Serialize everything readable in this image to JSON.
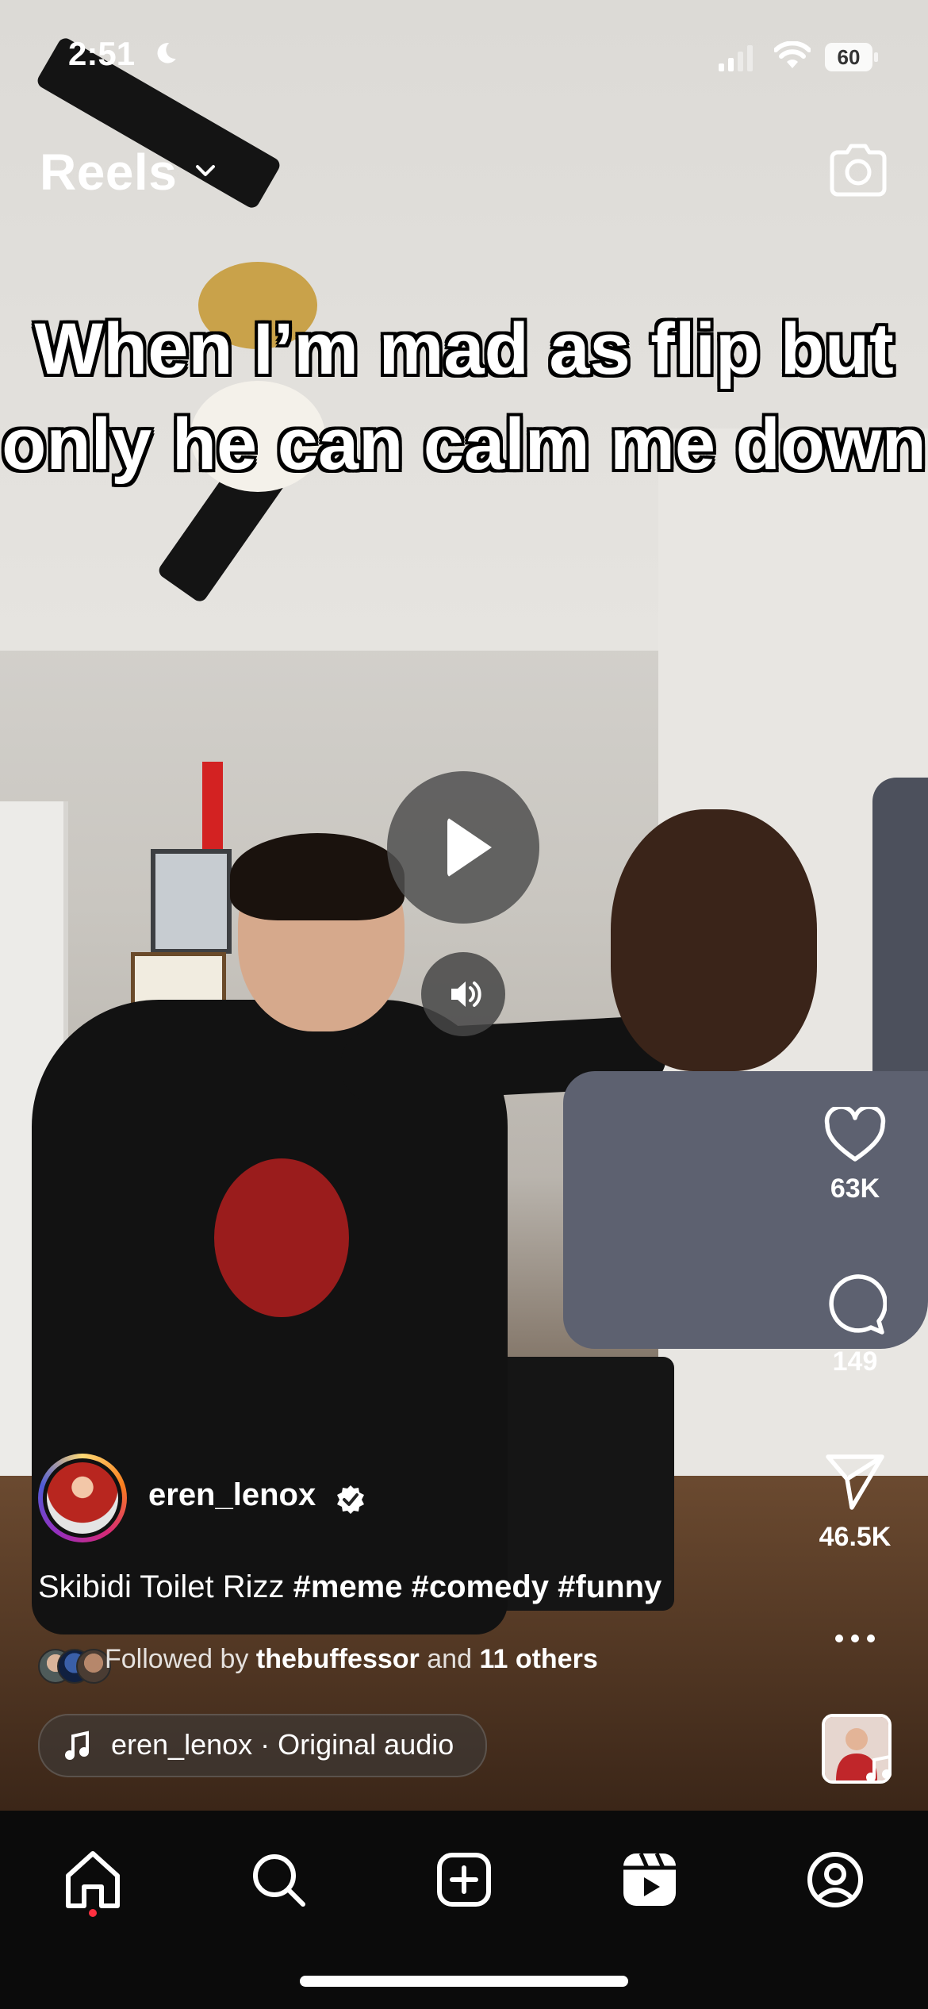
{
  "status_bar": {
    "time": "2:51",
    "battery": "60"
  },
  "header": {
    "title": "Reels"
  },
  "overlay_caption": "When I’m mad as flip but only he can calm me down",
  "actions": {
    "likes": "63K",
    "comments": "149",
    "shares": "46.5K"
  },
  "post": {
    "username": "eren_lenox",
    "caption_text": "Skibidi Toilet Rizz",
    "hashtags": [
      "#meme",
      "#comedy",
      "#funny"
    ],
    "followed_by_prefix": "Followed by",
    "followed_by_user": "thebuffessor",
    "followed_by_and": "and",
    "followed_by_others": "11 others",
    "audio": "eren_lenox · Original audio"
  },
  "icons": {
    "moon": "moon-icon",
    "signal": "signal-icon",
    "wifi": "wifi-icon",
    "battery": "battery-icon",
    "camera": "camera-icon",
    "play": "play-icon",
    "sound": "speaker-icon",
    "heart": "heart-icon",
    "comment": "comment-icon",
    "share": "send-icon",
    "more": "more-icon",
    "music": "music-note-icon",
    "verified": "verified-badge-icon",
    "nav": [
      "home-icon",
      "search-icon",
      "create-icon",
      "reels-icon",
      "profile-icon"
    ]
  },
  "colors": {
    "nav_background": "#0b0b0b",
    "notification_dot": "#ff3040",
    "avatar_ring_start": "#feda75",
    "avatar_ring_end": "#d62976"
  }
}
